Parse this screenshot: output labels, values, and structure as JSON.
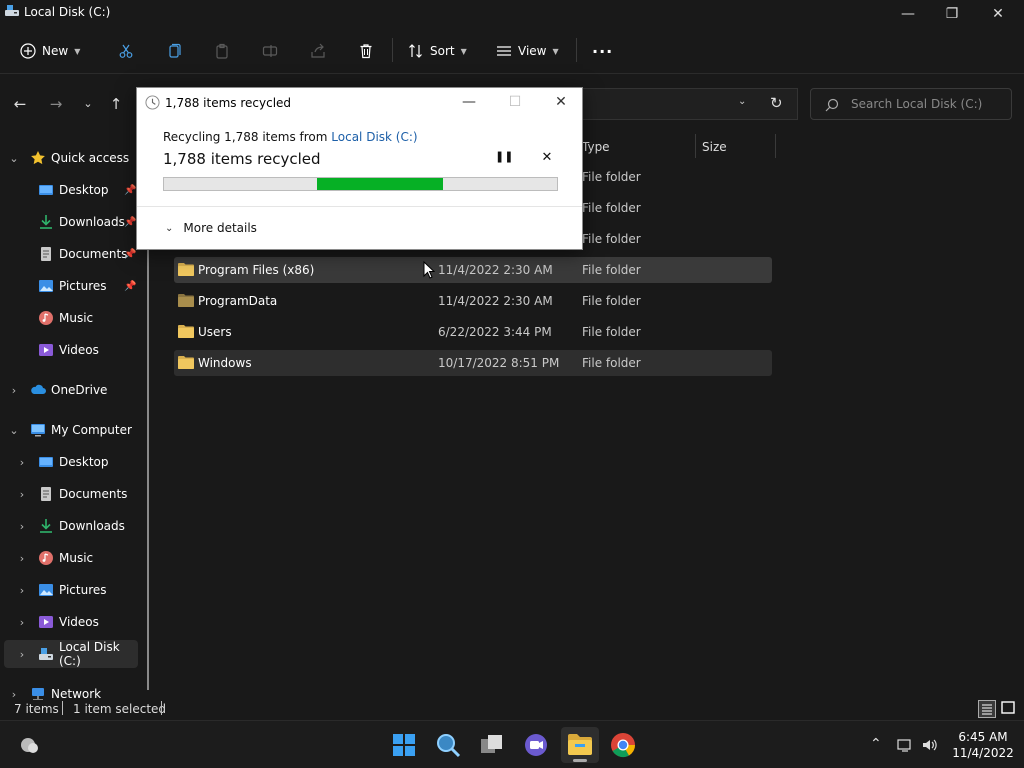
{
  "window": {
    "title": "Local Disk (C:)"
  },
  "toolbar": {
    "new_label": "New",
    "sort_label": "Sort",
    "view_label": "View",
    "more_label": "···"
  },
  "search": {
    "placeholder": "Search Local Disk (C:)"
  },
  "sidebar": {
    "items": [
      {
        "label": "Quick access"
      },
      {
        "label": "Desktop"
      },
      {
        "label": "Downloads"
      },
      {
        "label": "Documents"
      },
      {
        "label": "Pictures"
      },
      {
        "label": "Music"
      },
      {
        "label": "Videos"
      },
      {
        "label": "OneDrive"
      },
      {
        "label": "My Computer"
      },
      {
        "label": "Desktop"
      },
      {
        "label": "Documents"
      },
      {
        "label": "Downloads"
      },
      {
        "label": "Music"
      },
      {
        "label": "Pictures"
      },
      {
        "label": "Videos"
      },
      {
        "label": "Local Disk (C:)"
      },
      {
        "label": "Network"
      }
    ]
  },
  "columns": {
    "type": "Type",
    "size": "Size"
  },
  "files": [
    {
      "name": "",
      "date": "",
      "type": "File folder"
    },
    {
      "name": "",
      "date": "",
      "type": "File folder"
    },
    {
      "name": "",
      "date": "",
      "type": "File folder"
    },
    {
      "name": "Program Files (x86)",
      "date": "11/4/2022 2:30 AM",
      "type": "File folder"
    },
    {
      "name": "ProgramData",
      "date": "11/4/2022 2:30 AM",
      "type": "File folder"
    },
    {
      "name": "Users",
      "date": "6/22/2022 3:44 PM",
      "type": "File folder"
    },
    {
      "name": "Windows",
      "date": "10/17/2022 8:51 PM",
      "type": "File folder"
    }
  ],
  "status": {
    "count": "7 items",
    "selection": "1 item selected"
  },
  "dialog": {
    "title": "1,788 items recycled",
    "line_prefix": "Recycling 1,788 items from ",
    "line_link": "Local Disk (C:)",
    "headline": "1,788 items recycled",
    "progress_start": 0.39,
    "progress_end": 0.71,
    "more_details": "More details"
  },
  "clock": {
    "time": "6:45 AM",
    "date": "11/4/2022"
  },
  "colors": {
    "progress": "#06b025",
    "link": "#1c5fa8",
    "folder": "#f0c75e"
  }
}
